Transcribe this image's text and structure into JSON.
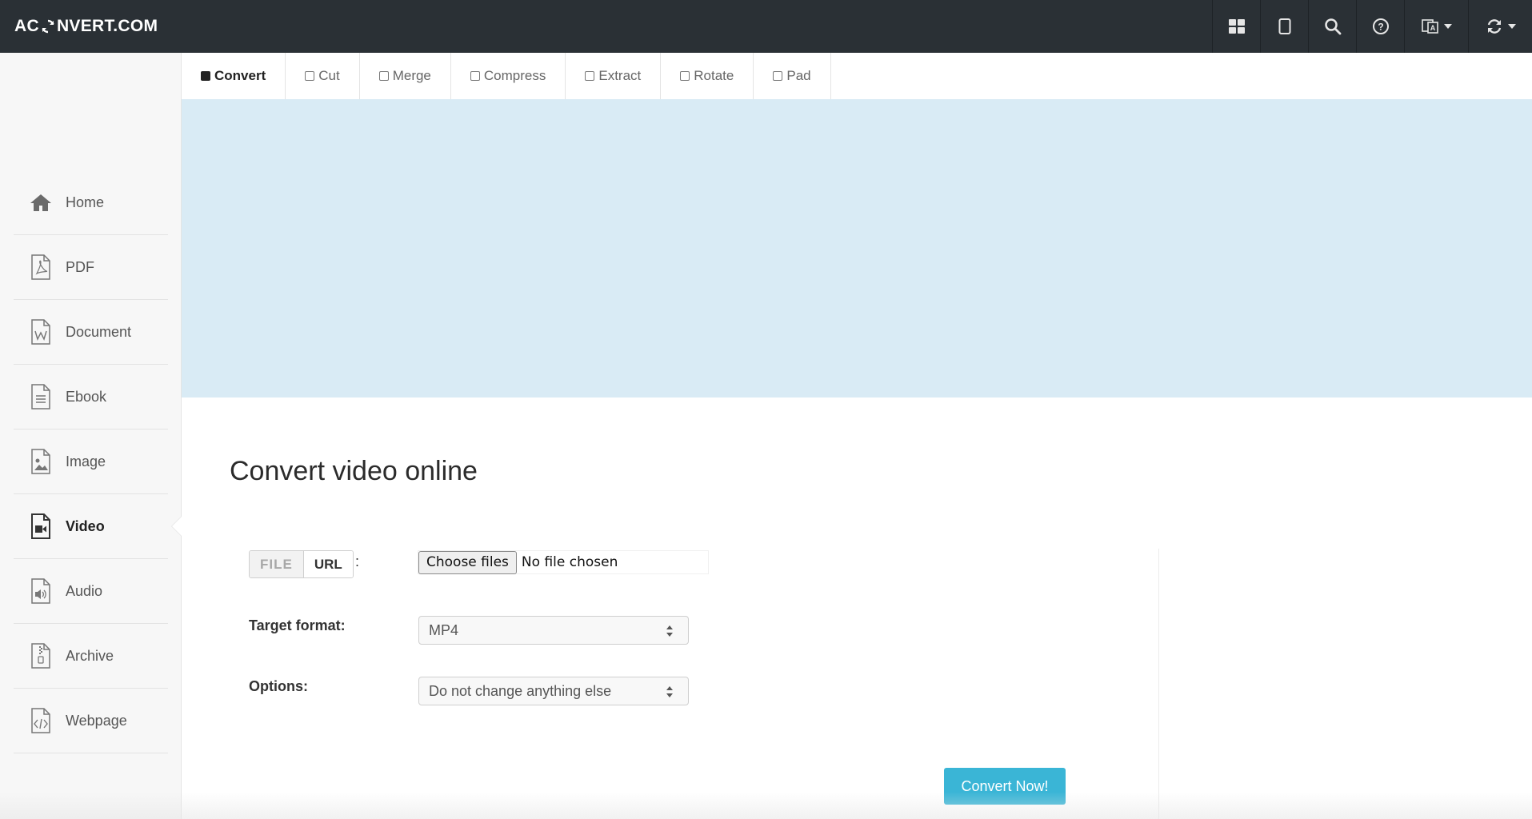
{
  "header": {
    "logo_left": "AC",
    "logo_right": "NVERT.COM",
    "icons": [
      "grid-icon",
      "tablet-icon",
      "search-icon",
      "help-icon",
      "language-icon",
      "refresh-icon"
    ]
  },
  "sidebar": {
    "items": [
      {
        "label": "Home",
        "icon": "home-icon"
      },
      {
        "label": "PDF",
        "icon": "pdf-file-icon"
      },
      {
        "label": "Document",
        "icon": "document-file-icon"
      },
      {
        "label": "Ebook",
        "icon": "ebook-file-icon"
      },
      {
        "label": "Image",
        "icon": "image-file-icon"
      },
      {
        "label": "Video",
        "icon": "video-file-icon",
        "active": true
      },
      {
        "label": "Audio",
        "icon": "audio-file-icon"
      },
      {
        "label": "Archive",
        "icon": "archive-file-icon"
      },
      {
        "label": "Webpage",
        "icon": "webpage-file-icon"
      }
    ]
  },
  "tabs": [
    {
      "label": "Convert",
      "active": true
    },
    {
      "label": "Cut"
    },
    {
      "label": "Merge"
    },
    {
      "label": "Compress"
    },
    {
      "label": "Extract"
    },
    {
      "label": "Rotate"
    },
    {
      "label": "Pad"
    }
  ],
  "main": {
    "title": "Convert video online",
    "source_toggle": {
      "file": "FILE",
      "url": "URL",
      "colon": ":"
    },
    "file_input": {
      "button": "Choose files",
      "status": "No file chosen"
    },
    "target_format": {
      "label": "Target format:",
      "value": "MP4"
    },
    "options": {
      "label": "Options:",
      "value": "Do not change anything else"
    },
    "submit": "Convert Now!"
  },
  "colors": {
    "topbar": "#2a3035",
    "banner": "#d9ebf5",
    "accent": "#3ab5d6"
  }
}
